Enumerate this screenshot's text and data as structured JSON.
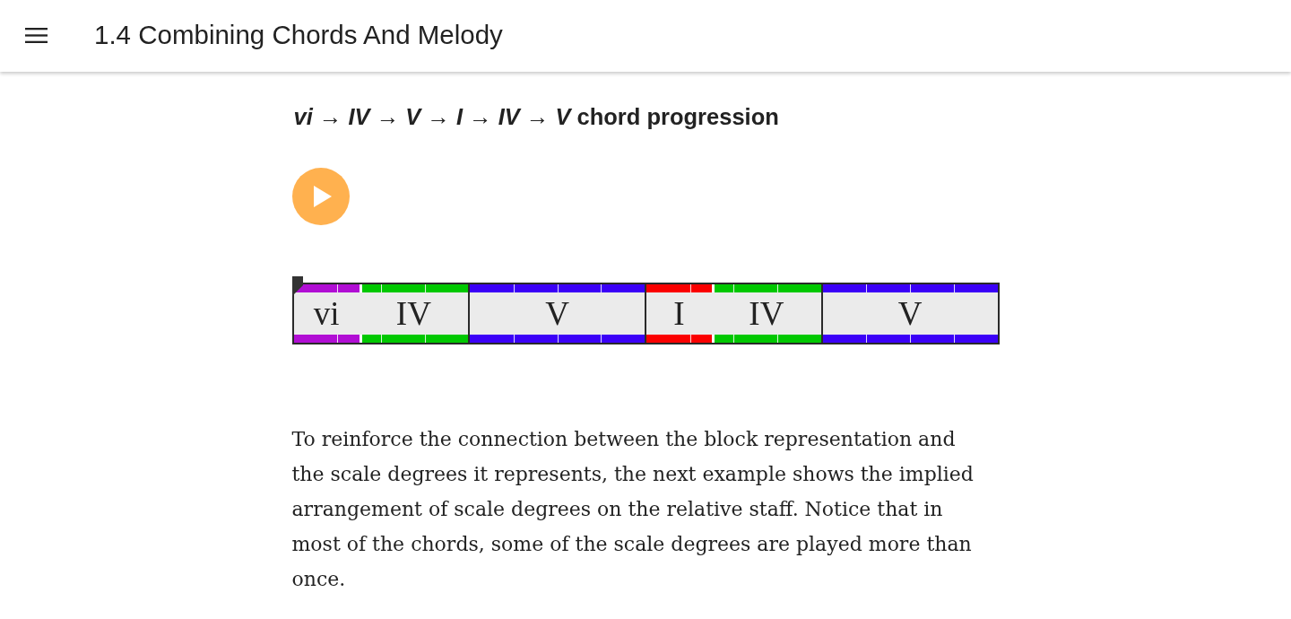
{
  "header": {
    "title": "1.4 Combining Chords And Melody"
  },
  "example": {
    "heading": "*vi* → *IV* → *V* → *I* → *IV* → *V* chord progression"
  },
  "chord_strip": {
    "measures": [
      {
        "chords": [
          {
            "label": "vi",
            "color": "#b10ed4",
            "level": 0.375
          },
          {
            "label": "IV",
            "color": "#00c800",
            "level": 0.625
          }
        ]
      },
      {
        "chords": [
          {
            "label": "V",
            "color": "#3b00f7",
            "level": 1
          }
        ]
      },
      {
        "chords": [
          {
            "label": "I",
            "color": "#fb0000",
            "level": 0.375
          },
          {
            "label": "IV",
            "color": "#00c800",
            "level": 0.625
          }
        ]
      },
      {
        "chords": [
          {
            "label": "V",
            "color": "#3b00f7",
            "level": 1
          }
        ]
      }
    ]
  },
  "paragraph": "To reinforce the connection between the block representation and the scale degrees it represents, the next example shows the implied arrangement of scale degrees on the relative staff. Notice that in most of the chords, some of the scale degrees are played more than once."
}
